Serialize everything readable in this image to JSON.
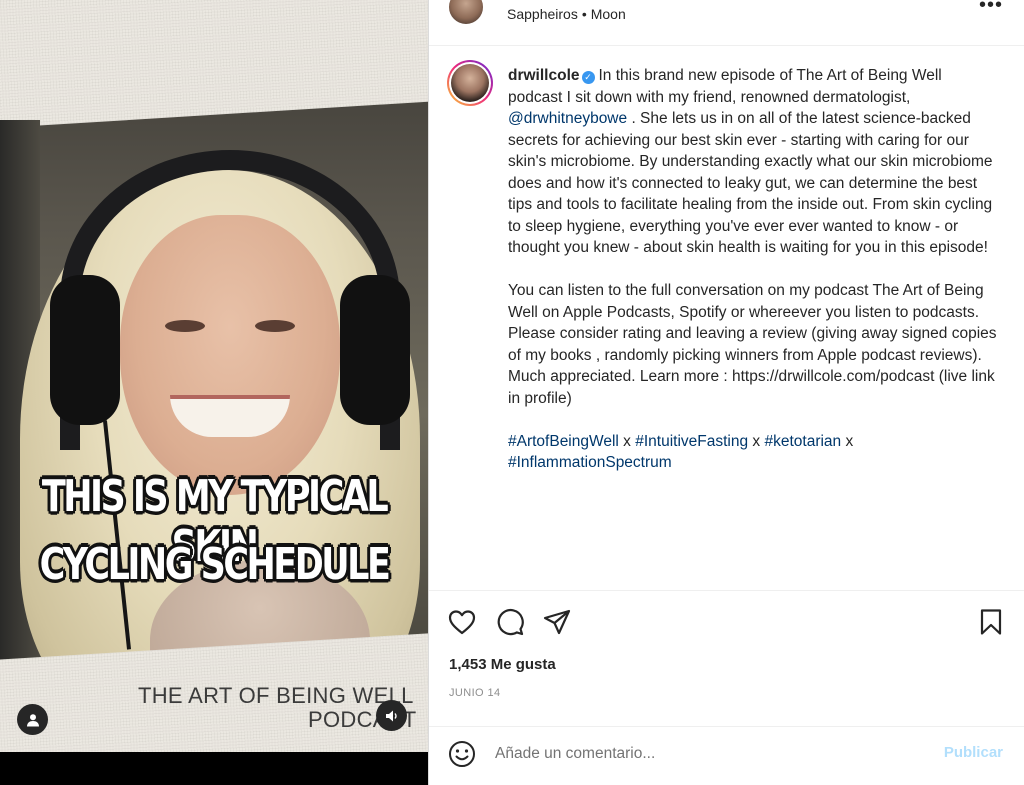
{
  "video": {
    "overlay_line1": "THIS IS MY TYPICAL SKIN",
    "overlay_line2": "CYCLING SCHEDULE",
    "podcast_line1": "THE ART OF BEING WELL",
    "podcast_line2": "PODCAST"
  },
  "header": {
    "audio_artist": "Sappheiros",
    "audio_separator": "•",
    "audio_track": "Moon",
    "more_label": "•••"
  },
  "post": {
    "username": "drwillcole",
    "verified_mark": "✓",
    "caption_p1_a": "In this brand new episode of The Art of Being Well podcast I sit down with my friend, renowned dermatologist, ",
    "mention": "@drwhitneybowe",
    "caption_p1_b": " . She lets us in on all of the latest science-backed secrets for achieving our best skin ever - starting with caring for our skin's microbiome. By understanding exactly what our skin microbiome does and how it's connected to leaky gut, we can determine the best tips and tools to facilitate healing from the inside out. From skin cycling to sleep hygiene, everything you've ever ever wanted to know - or thought you knew - about skin health is waiting for you in this episode!",
    "caption_p2": "You can listen to the full conversation on my podcast The Art of Being Well on Apple Podcasts, Spotify or whereever you listen to podcasts. Please consider rating and leaving a review (giving away signed copies of my books , randomly picking winners from Apple podcast reviews). Much appreciated. Learn more : https://drwillcole.com/podcast (live link in profile)",
    "hashtags": [
      {
        "tag": "#ArtofBeingWell",
        "after": " x "
      },
      {
        "tag": "#IntuitiveFasting",
        "after": " x "
      },
      {
        "tag": "#ketotarian",
        "after": " x "
      },
      {
        "tag": "#InflammationSpectrum",
        "after": ""
      }
    ],
    "likes": "1,453 Me gusta",
    "date": "JUNIO 14"
  },
  "comment": {
    "placeholder": "Añade un comentario...",
    "publish_label": "Publicar"
  },
  "colors": {
    "link": "#00376b",
    "publish_disabled": "#b2dffc",
    "verified": "#3897f0"
  },
  "icons": [
    "user-tag-icon",
    "sound-off-icon",
    "heart-icon",
    "comment-icon",
    "share-icon",
    "bookmark-icon",
    "emoji-icon",
    "more-icon",
    "verified-icon"
  ]
}
